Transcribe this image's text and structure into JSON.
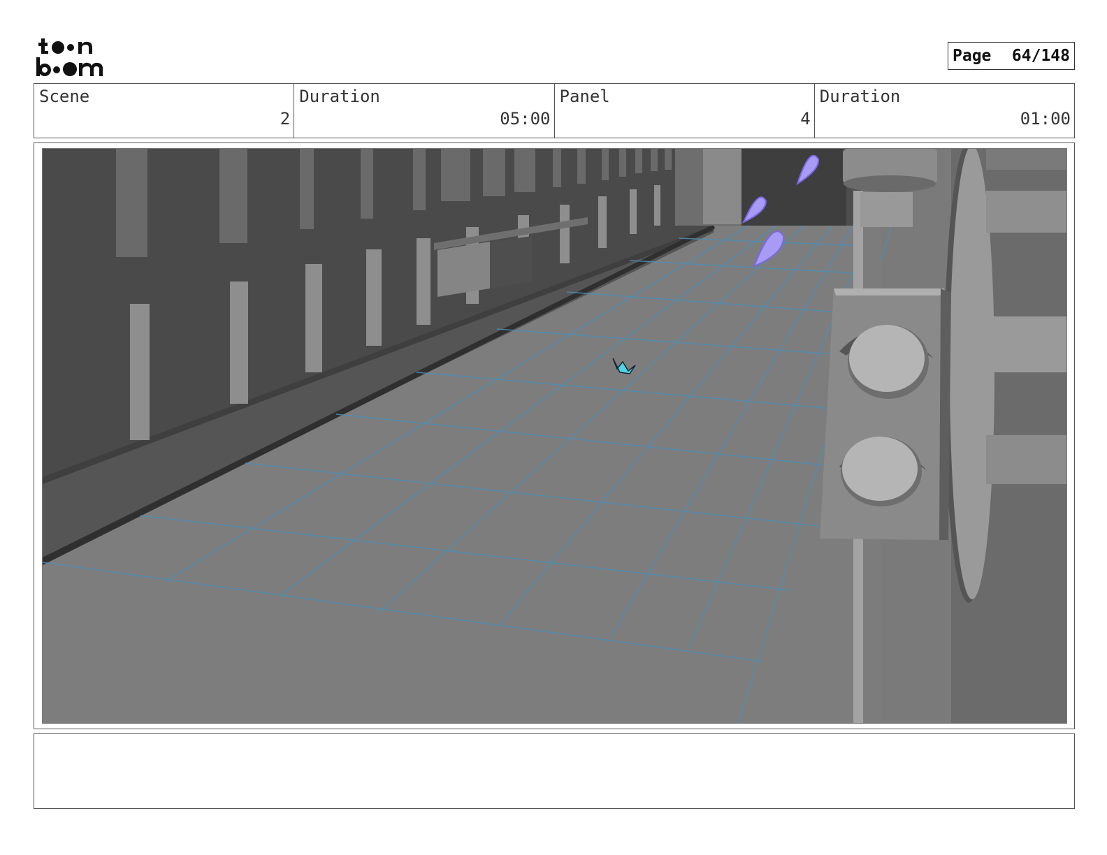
{
  "brand": {
    "logo_text_line1": "toon",
    "logo_text_line2": "boom"
  },
  "page": {
    "label": "Page",
    "number": "64/148"
  },
  "header": {
    "scene_label": "Scene",
    "scene_value": "2",
    "scene_duration_label": "Duration",
    "scene_duration_value": "05:00",
    "panel_label": "Panel",
    "panel_value": "4",
    "panel_duration_label": "Duration",
    "panel_duration_value": "01:00"
  },
  "notes": {
    "text": ""
  }
}
